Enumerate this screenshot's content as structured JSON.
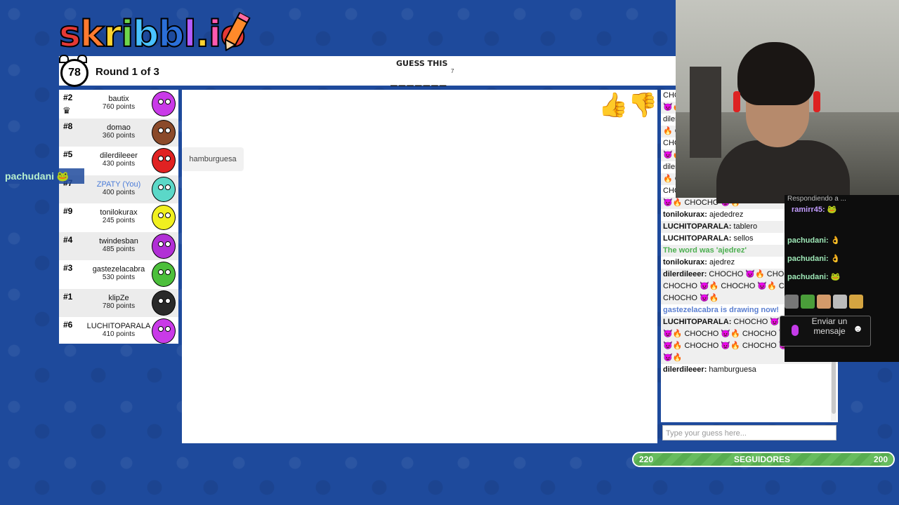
{
  "logo": {
    "letters": [
      "s",
      "k",
      "r",
      "i",
      "b",
      "b",
      "l",
      ".",
      "i",
      "o"
    ],
    "colors": [
      "#e53935",
      "#ff7a2f",
      "#ffd331",
      "#6fd64b",
      "#49c2ff",
      "#2b6fd8",
      "#b35cff",
      "#ffd331",
      "#ff5ab0",
      "#e53935"
    ],
    "text": "skribbl.io"
  },
  "topbar": {
    "timer": "78",
    "round": "Round 1 of 3",
    "guess_label": "GUESS THIS",
    "blanks": "_______",
    "word_length": "7"
  },
  "players": [
    {
      "rank": "#2",
      "name": "bautix",
      "points": "760 points",
      "color": "#c93ae8",
      "crown": true
    },
    {
      "rank": "#8",
      "name": "domao",
      "points": "360 points",
      "color": "#8b4a2a"
    },
    {
      "rank": "#5",
      "name": "dilerdileeer",
      "points": "430 points",
      "color": "#e02222"
    },
    {
      "rank": "#7",
      "name": "ZPATY (You)",
      "points": "400 points",
      "color": "#5bd8c8",
      "you": true
    },
    {
      "rank": "#9",
      "name": "tonilokurax",
      "points": "245 points",
      "color": "#f0f020"
    },
    {
      "rank": "#4",
      "name": "twindesban",
      "points": "485 points",
      "color": "#b12fd6"
    },
    {
      "rank": "#3",
      "name": "gastezelacabra",
      "points": "530 points",
      "color": "#4cbf3b"
    },
    {
      "rank": "#1",
      "name": "klipZe",
      "points": "780 points",
      "color": "#2a2a2a"
    },
    {
      "rank": "#6",
      "name": "LUCHITOPARALA",
      "points": "410 points",
      "color": "#c93ae8"
    }
  ],
  "canvas": {
    "bubble_text": "hamburguesa"
  },
  "chat": {
    "messages": [
      {
        "type": "plain",
        "text": "CHOCHO 👿🔥 CHOCHO 👿🔥"
      },
      {
        "type": "plain",
        "text": "👿🔥 CHOCHO 👿🔥"
      },
      {
        "type": "plain",
        "text": "dilerdileeer: CHOCHO 👿🔥"
      },
      {
        "type": "plain",
        "text": "🔥 CHOCHO 👿🔥"
      },
      {
        "type": "plain",
        "text": "CHOCHO 👿🔥 CHOCHO"
      },
      {
        "type": "plain",
        "text": "👿🔥 CHOCHO 👿🔥"
      },
      {
        "type": "plain",
        "text": "dilerdileeer: CHOCHO"
      },
      {
        "type": "plain",
        "text": "🔥 CHOCHO 👿🔥"
      },
      {
        "type": "plain",
        "text": "CHOCHO 👿🔥 CHOCHO"
      },
      {
        "type": "plain",
        "text": "👿🔥 CHOCHO 👿🔥"
      },
      {
        "type": "user",
        "user": "tonilokurax:",
        "text": " ajededrez"
      },
      {
        "type": "user",
        "user": "LUCHITOPARALA:",
        "text": " tablero"
      },
      {
        "type": "user",
        "user": "LUCHITOPARALA:",
        "text": " sellos"
      },
      {
        "type": "green",
        "text": "The word was 'ajedrez'"
      },
      {
        "type": "user",
        "user": "tonilokurax:",
        "text": " ajedrez"
      },
      {
        "type": "user",
        "user": "dilerdileeer:",
        "text": " CHOCHO 👿🔥 CHOCHO 👿🔥 CHOCHO 👿🔥 CHOCHO 👿🔥 CHOCHO 👿🔥 CHOCHO 👿🔥"
      },
      {
        "type": "blue",
        "text": "gastezelacabra is drawing now!"
      },
      {
        "type": "user",
        "user": "LUCHITOPARALA:",
        "text": " CHOCHO 👿🔥 CHOCHO 👿🔥 CHOCHO 👿🔥 CHOCHO 👿🔥 CHOCHO 👿🔥 CHOCHO 👿🔥 CHOCHO 👿🔥 CHOCHO 👿🔥"
      },
      {
        "type": "user",
        "user": "dilerdileeer:",
        "text": " hamburguesa"
      }
    ],
    "input_placeholder": "Type your guess here..."
  },
  "stream_chat": {
    "reply_header": "Respondiendo a ...",
    "rows": [
      {
        "user": "ramirr45:",
        "emote": "🐸"
      },
      {
        "user": "pachudani:",
        "emote": "👌"
      },
      {
        "user": "pachudani:",
        "emote": "👌"
      },
      {
        "user": "pachudani:",
        "emote": "🐸"
      }
    ],
    "send_label": "Enviar un mensaje",
    "overlay_user": "pachudani",
    "overlay_emote": "🐸"
  },
  "followers": {
    "current": "220",
    "label": "SEGUIDORES",
    "goal": "200",
    "progress": 1.0
  }
}
